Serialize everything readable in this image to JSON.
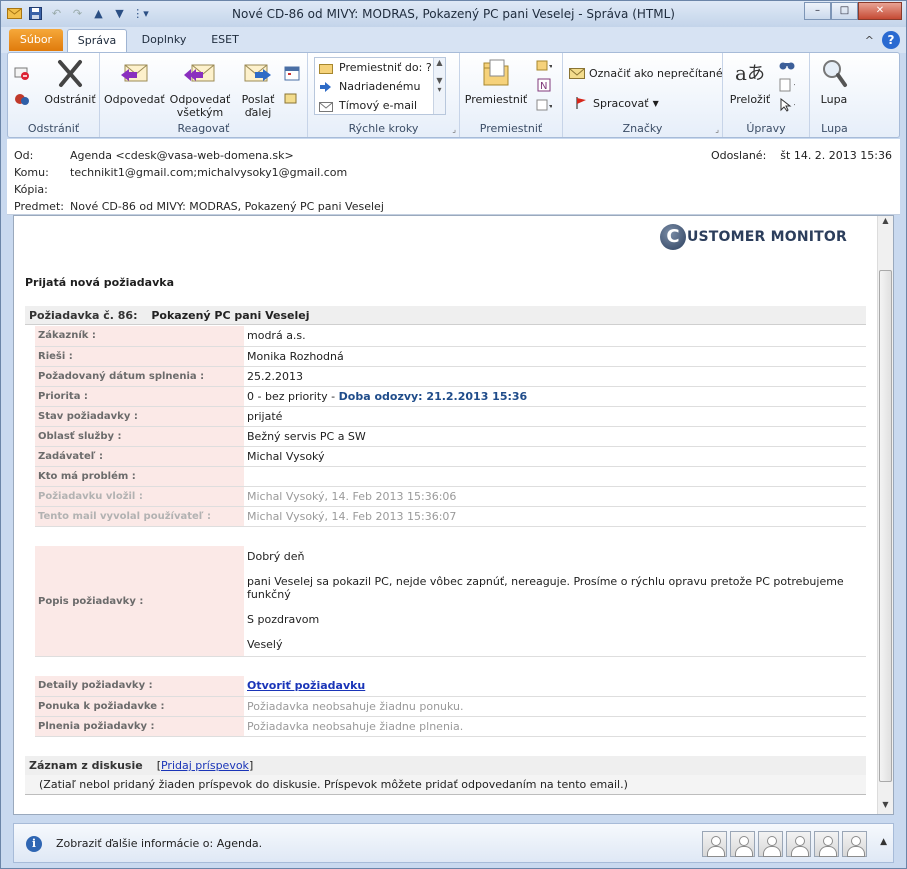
{
  "window": {
    "title": "Nové CD-86 od MIVY: MODRAS, Pokazený PC pani Veselej  -  Správa (HTML)",
    "min": "–",
    "max": "□",
    "close": "✕"
  },
  "tabs": {
    "file": "Súbor",
    "items": [
      "Správa",
      "Doplnky",
      "ESET"
    ],
    "help": "?",
    "collapse": "^"
  },
  "ribbon": {
    "delete_group": {
      "label": "Odstrániť",
      "delete": "Odstrániť"
    },
    "respond_group": {
      "label": "Reagovať",
      "reply": "Odpovedať",
      "reply_all_1": "Odpovedať",
      "reply_all_2": "všetkým",
      "forward_1": "Poslať",
      "forward_2": "ďalej"
    },
    "quick_group": {
      "label": "Rýchle kroky",
      "items": [
        "Premiestniť do: ?",
        "Nadriadenému",
        "Tímový e-mail"
      ]
    },
    "move_group": {
      "label": "Premiestniť",
      "move": "Premiestniť"
    },
    "tags_group": {
      "label": "Značky",
      "mark_unread": "Označiť ako neprečítané",
      "followup": "Spracovať"
    },
    "edit_group": {
      "label": "Úpravy",
      "translate": "Preložiť"
    },
    "zoom_group": {
      "label": "Lupa",
      "zoom": "Lupa"
    }
  },
  "header": {
    "from_label": "Od:",
    "from": "Agenda <cdesk@vasa-web-domena.sk>",
    "to_label": "Komu:",
    "to": "technikit1@gmail.com;michalvysoky1@gmail.com",
    "cc_label": "Kópia:",
    "cc": "",
    "subject_label": "Predmet:",
    "subject": "Nové CD-86 od MIVY: MODRAS, Pokazený PC pani Veselej",
    "sent_label": "Odoslané:",
    "sent": "št 14. 2. 2013 15:36"
  },
  "message": {
    "logo_letter": "C",
    "logo_text": "USTOMER MONITOR",
    "intro": "Prijatá nová požiadavka",
    "request_label": "Požiadavka č. 86:",
    "request_title": "Pokazený PC pani Veselej",
    "fields": [
      {
        "k": "Zákazník :",
        "v": "modrá a.s."
      },
      {
        "k": "Rieši :",
        "v": "Monika Rozhodná"
      },
      {
        "k": "Požadovaný dátum splnenia :",
        "v": "25.2.2013"
      },
      {
        "k": "Priorita :",
        "v": "0 - bez priority - ",
        "extra": "Doba odozvy: 21.2.2013 15:36"
      },
      {
        "k": "Stav požiadavky :",
        "v": "prijaté"
      },
      {
        "k": "Oblasť služby :",
        "v": "Bežný servis PC a SW"
      },
      {
        "k": "Zadávateľ :",
        "v": "Michal Vysoký"
      },
      {
        "k": "Kto má problém :",
        "v": ""
      },
      {
        "k": "Požiadavku vložil :",
        "v": "Michal Vysoký, 14. Feb 2013 15:36:06"
      },
      {
        "k": "Tento mail vyvolal používateľ :",
        "v": "Michal Vysoký, 14. Feb 2013 15:36:07"
      }
    ],
    "desc_label": "Popis požiadavky :",
    "desc_lines": [
      "Dobrý deň",
      "pani Veselej sa pokazil PC, nejde vôbec zapnúť, nereaguje. Prosíme o rýchlu opravu pretože PC potrebujeme funkčný",
      "S pozdravom",
      "Veselý"
    ],
    "details": {
      "k1": "Detaily požiadavky :",
      "link": "Otvoriť požiadavku",
      "k2": "Ponuka k požiadavke :",
      "v2": "Požiadavka neobsahuje žiadnu ponuku.",
      "k3": "Plnenia požiadavky :",
      "v3": "Požiadavka neobsahuje žiadne plnenia."
    },
    "discussion_title": "Záznam z diskusie",
    "discussion_add": "Pridaj príspevok",
    "discussion_note": "(Zatiaľ nebol pridaný žiaden príspevok do diskusie. Príspevok môžete pridať odpovedaním na tento email.)"
  },
  "people_pane": {
    "text": "Zobraziť ďalšie informácie o: Agenda.",
    "avatars": 6
  }
}
